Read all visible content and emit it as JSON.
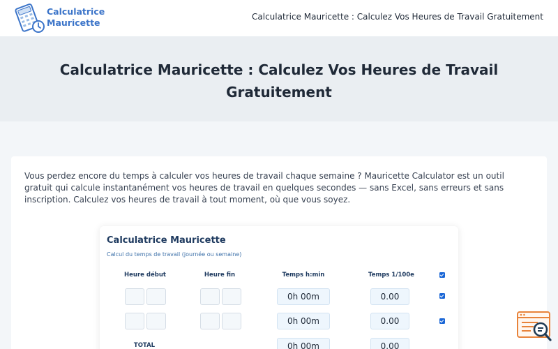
{
  "header": {
    "brand_line1": "Calculatrice",
    "brand_line2": "Mauricette",
    "nav_title": "Calculatrice Mauricette : Calculez Vos Heures de Travail Gratuitement"
  },
  "hero": {
    "title": "Calculatrice Mauricette : Calculez Vos Heures de Travail Gratuitement"
  },
  "intro": "Vous perdez encore du temps à calculer vos heures de travail chaque semaine ? Mauricette Calculator est un outil gratuit qui calcule instantanément vos heures de travail en quelques secondes — sans Excel, sans erreurs et sans inscription. Calculez vos heures de travail à tout moment, où que vous soyez.",
  "calculator": {
    "title": "Calculatrice Mauricette",
    "subtitle": "Calcul du temps de travail (journée ou semaine)",
    "columns": {
      "start": "Heure début",
      "end": "Heure fin",
      "hm": "Temps h:min",
      "decimal": "Temps 1/100e"
    },
    "rows": [
      {
        "hm": "0h 00m",
        "decimal": "0.00",
        "checked": true
      },
      {
        "hm": "0h 00m",
        "decimal": "0.00",
        "checked": true
      }
    ],
    "total": {
      "label": "TOTAL",
      "hm": "0h 00m",
      "decimal": "0.00"
    }
  },
  "icons": {
    "logo": "calculator-clock-icon",
    "floating": "search-document-icon"
  },
  "colors": {
    "brand": "#3b74c9",
    "checkbox": "#1a66d6",
    "heading": "#1e3a5f",
    "float_icon": "#e8833a"
  }
}
